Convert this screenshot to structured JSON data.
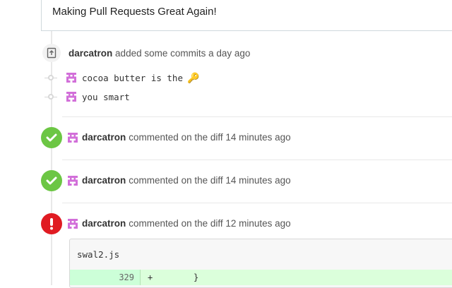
{
  "pr": {
    "description": "Making Pull Requests Great Again!"
  },
  "commit_event": {
    "author": "darcatron",
    "action": "added some commits a day ago",
    "commits": [
      {
        "message": "cocoa butter is the",
        "emoji": "🔑"
      },
      {
        "message": "you smart",
        "emoji": ""
      }
    ]
  },
  "comments": [
    {
      "status": "success",
      "author": "darcatron",
      "action": "commented on the diff 14 minutes ago"
    },
    {
      "status": "success",
      "author": "darcatron",
      "action": "commented on the diff 14 minutes ago"
    },
    {
      "status": "error",
      "author": "darcatron",
      "action": "commented on the diff 12 minutes ago"
    }
  ],
  "diff": {
    "file_name": "swal2.js",
    "line_number": "329",
    "line_code": "+        }"
  },
  "icons": {
    "commit": "commit-icon",
    "success": "check-circle-icon",
    "error": "exclamation-circle-icon",
    "avatar": "identicon-avatar"
  },
  "colors": {
    "success": "#6cc644",
    "error": "#e01b22",
    "avatar": "#d26fd9"
  }
}
